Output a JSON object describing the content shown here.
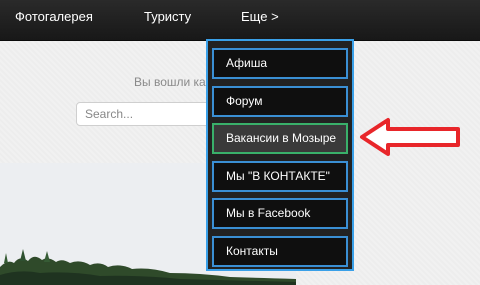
{
  "nav": {
    "items": [
      {
        "label": "Фотогалерея"
      },
      {
        "label": "Туристу"
      },
      {
        "label": "Еще >"
      }
    ]
  },
  "main": {
    "login_text": "Вы вошли ка",
    "search": {
      "placeholder": "Search..."
    }
  },
  "dropdown": {
    "items": [
      {
        "label": "Афиша"
      },
      {
        "label": "Форум"
      },
      {
        "label": "Вакансии в Мозыре",
        "active": true
      },
      {
        "label": "Мы \"В КОНТАКТЕ\""
      },
      {
        "label": "Мы в Facebook"
      },
      {
        "label": "Контакты"
      }
    ]
  },
  "annotation": {
    "icon": "arrow-left-icon",
    "color": "#e8262a"
  },
  "colors": {
    "accent": "#3aa0e8",
    "active_border": "#39b06a",
    "nav_bg": "#1c1c1c"
  }
}
